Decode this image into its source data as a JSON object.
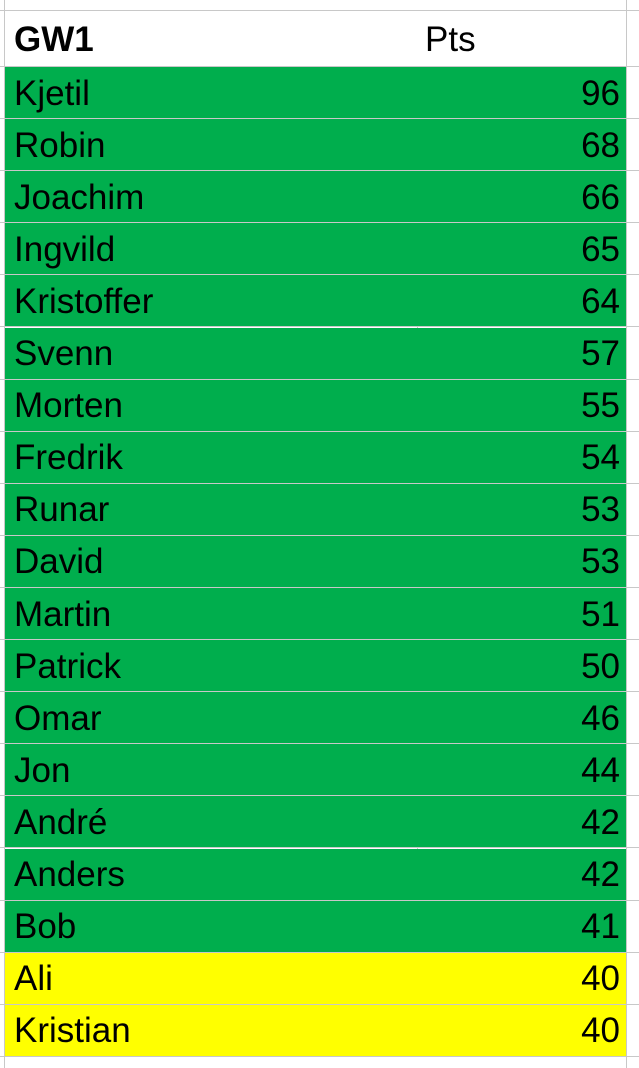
{
  "sheet": {
    "colors": {
      "green": "#00AE4D",
      "yellow": "#FFFF00",
      "gridline": "#c8c8c8",
      "text": "#000000",
      "background": "#ffffff"
    },
    "header": {
      "name_label": "GW1",
      "pts_label": "Pts"
    },
    "rows": [
      {
        "name": "Kjetil",
        "pts": "96",
        "band": "green"
      },
      {
        "name": "Robin",
        "pts": "68",
        "band": "green"
      },
      {
        "name": "Joachim",
        "pts": "66",
        "band": "green"
      },
      {
        "name": "Ingvild",
        "pts": "65",
        "band": "green"
      },
      {
        "name": "Kristoffer",
        "pts": "64",
        "band": "green"
      },
      {
        "name": "Svenn",
        "pts": "57",
        "band": "green"
      },
      {
        "name": "Morten",
        "pts": "55",
        "band": "green"
      },
      {
        "name": "Fredrik",
        "pts": "54",
        "band": "green"
      },
      {
        "name": "Runar",
        "pts": "53",
        "band": "green"
      },
      {
        "name": "David",
        "pts": "53",
        "band": "green"
      },
      {
        "name": "Martin",
        "pts": "51",
        "band": "green"
      },
      {
        "name": "Patrick",
        "pts": "50",
        "band": "green"
      },
      {
        "name": "Omar",
        "pts": "46",
        "band": "green"
      },
      {
        "name": "Jon",
        "pts": "44",
        "band": "green"
      },
      {
        "name": "André",
        "pts": "42",
        "band": "green"
      },
      {
        "name": "Anders",
        "pts": "42",
        "band": "green"
      },
      {
        "name": "Bob",
        "pts": "41",
        "band": "green"
      },
      {
        "name": "Ali",
        "pts": "40",
        "band": "yellow"
      },
      {
        "name": "Kristian",
        "pts": "40",
        "band": "yellow"
      }
    ]
  }
}
